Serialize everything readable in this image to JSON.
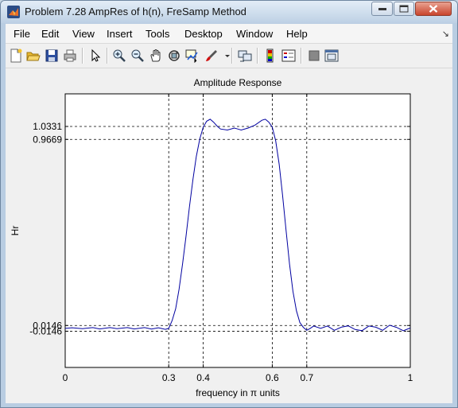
{
  "window": {
    "title": "Problem 7.28 AmpRes of h(n), FreSamp Method"
  },
  "menu": {
    "items": [
      "File",
      "Edit",
      "View",
      "Insert",
      "Tools",
      "Desktop",
      "Window",
      "Help"
    ],
    "arrow": "↘"
  },
  "toolbar": {
    "buttons": [
      "new-figure-icon",
      "open-file-icon",
      "save-icon",
      "print-icon",
      "pointer-icon",
      "zoom-in-icon",
      "zoom-out-icon",
      "pan-icon",
      "rotate-3d-icon",
      "data-cursor-icon",
      "brush-icon",
      "link-icon",
      "colorbar-icon",
      "legend-icon",
      "hide-plot-tools-icon",
      "show-plot-tools-icon"
    ]
  },
  "chart_data": {
    "type": "line",
    "title": "Amplitude Response",
    "xlabel": "frequency in π units",
    "ylabel": "Hr",
    "xlim": [
      0,
      1
    ],
    "ylim": [
      -0.2,
      1.2
    ],
    "xticks": [
      0,
      0.3,
      0.4,
      0.6,
      0.7,
      1
    ],
    "xticklabels": [
      "0",
      "0.3",
      "0.4",
      "0.6",
      "0.7",
      "1"
    ],
    "yticks": [
      -0.0146,
      0.0146,
      0.9669,
      1.0331
    ],
    "yticklabels": [
      "-0.0146",
      "0.0146",
      "0.9669",
      "1.0331"
    ],
    "grid": "dashed lines at tick positions",
    "series": [
      {
        "color": "#0000a0",
        "x": [
          0,
          0.02,
          0.05,
          0.08,
          0.1,
          0.13,
          0.15,
          0.18,
          0.2,
          0.23,
          0.25,
          0.27,
          0.29,
          0.3,
          0.31,
          0.32,
          0.33,
          0.34,
          0.35,
          0.36,
          0.37,
          0.38,
          0.39,
          0.4,
          0.41,
          0.42,
          0.43,
          0.44,
          0.45,
          0.47,
          0.49,
          0.5,
          0.51,
          0.53,
          0.55,
          0.57,
          0.58,
          0.59,
          0.6,
          0.61,
          0.62,
          0.63,
          0.64,
          0.65,
          0.66,
          0.67,
          0.68,
          0.69,
          0.7,
          0.71,
          0.72,
          0.74,
          0.76,
          0.78,
          0.8,
          0.82,
          0.84,
          0.86,
          0.88,
          0.9,
          0.92,
          0.94,
          0.96,
          0.98,
          1.0
        ],
        "y": [
          0.0,
          0.003,
          -0.002,
          0.004,
          -0.003,
          0.004,
          -0.002,
          0.004,
          -0.003,
          0.004,
          -0.004,
          0.003,
          -0.005,
          0.0,
          0.04,
          0.1,
          0.2,
          0.33,
          0.47,
          0.62,
          0.76,
          0.88,
          0.97,
          1.03,
          1.06,
          1.07,
          1.055,
          1.035,
          1.02,
          1.015,
          1.025,
          1.02,
          1.015,
          1.025,
          1.04,
          1.065,
          1.07,
          1.055,
          1.03,
          0.96,
          0.84,
          0.68,
          0.5,
          0.33,
          0.19,
          0.09,
          0.03,
          0.005,
          -0.01,
          0.0,
          0.012,
          0.0,
          0.012,
          -0.01,
          0.006,
          0.013,
          -0.006,
          -0.012,
          0.012,
          0.006,
          -0.01,
          0.016,
          0.005,
          -0.012,
          0.002
        ]
      }
    ]
  }
}
